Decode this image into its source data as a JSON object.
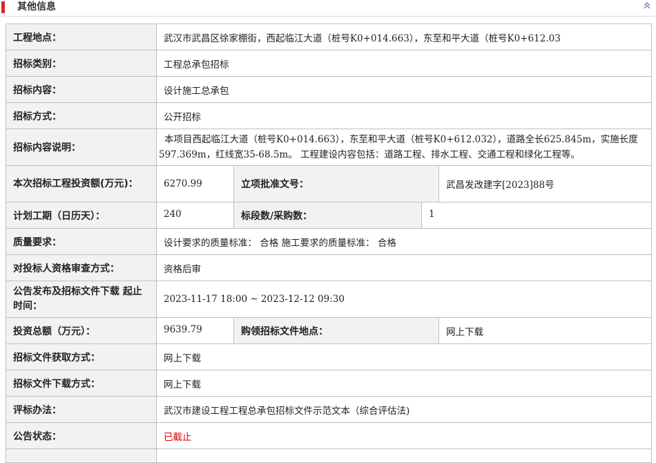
{
  "section": {
    "title": "其他信息",
    "collapse_icon": "double-chevron-up-icon",
    "accent": "#d9232d"
  },
  "rows": {
    "location": {
      "label": "工程地点：",
      "value": "武汉市武昌区徐家棚街，西起临江大道（桩号K0+014.663），东至和平大道（桩号K0+612.03"
    },
    "tender_type": {
      "label": "招标类别：",
      "value": "工程总承包招标"
    },
    "tender_content": {
      "label": "招标内容：",
      "value": "设计施工总承包"
    },
    "tender_method": {
      "label": "招标方式：",
      "value": "公开招标"
    },
    "content_desc": {
      "label": "招标内容说明：",
      "value": "本项目西起临江大道（桩号K0+014.663），东至和平大道（桩号K0+612.032），道路全长625.845m，实施长度597.369m，红线宽35-68.5m。 工程建设内容包括：道路工程、排水工程、交通工程和绿化工程等。"
    },
    "investment": {
      "label": "本次招标工程投资额(万元)：",
      "value": "6270.99",
      "label2": "立项批准文号：",
      "value2": "武昌发改建字[2023]88号"
    },
    "duration": {
      "label": "计划工期（日历天）：",
      "value": "240",
      "label2": "标段数/采购数：",
      "value2": "1"
    },
    "quality": {
      "label": "质量要求：",
      "value": "设计要求的质量标准： 合格 施工要求的质量标准： 合格"
    },
    "qualification": {
      "label": "对投标人资格审查方式：",
      "value": "资格后审"
    },
    "publish_time": {
      "label": "公告发布及招标文件下载 起止时间：",
      "value": "2023-11-17 18:00 ~ 2023-12-12 09:30"
    },
    "total_invest": {
      "label": "投资总额（万元）：",
      "value": "9639.79",
      "label2": "购领招标文件地点：",
      "value2": "网上下载"
    },
    "doc_obtain": {
      "label": "招标文件获取方式：",
      "value": "网上下载"
    },
    "doc_download": {
      "label": "招标文件下载方式：",
      "value": "网上下载"
    },
    "evaluation": {
      "label": "评标办法：",
      "value": "武汉市建设工程工程总承包招标文件示范文本（综合评估法)"
    },
    "status": {
      "label": "公告状态：",
      "value": "已截止",
      "color": "#e00000"
    }
  }
}
